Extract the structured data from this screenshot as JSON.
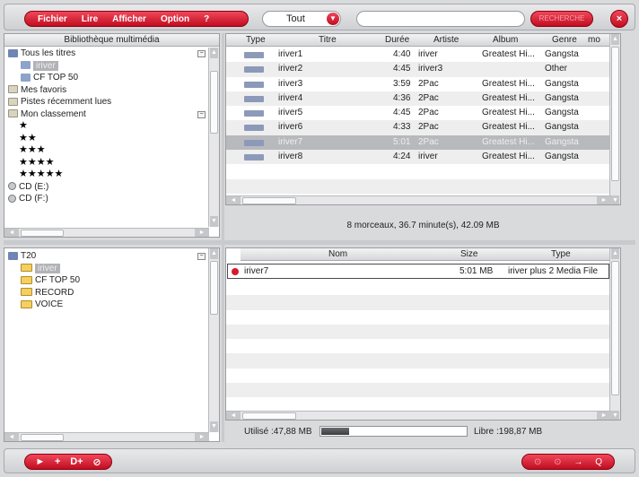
{
  "menu": {
    "items": [
      "Fichier",
      "Lire",
      "Afficher",
      "Option",
      "?"
    ]
  },
  "filter": {
    "value": "Tout"
  },
  "search": {
    "placeholder": "",
    "button_label": "RECHERCHE"
  },
  "library": {
    "title": "Bibliothèque multimédia",
    "items": [
      {
        "label": "Tous les titres",
        "level": 0,
        "icon": "library-icon"
      },
      {
        "label": "iriver",
        "level": 1,
        "icon": "playlist-icon",
        "selected": true
      },
      {
        "label": "CF TOP 50",
        "level": 1,
        "icon": "playlist-icon"
      },
      {
        "label": "Mes favoris",
        "level": 0,
        "icon": "folder-icon"
      },
      {
        "label": "Pistes récemment lues",
        "level": 0,
        "icon": "folder-icon"
      },
      {
        "label": "Mon classement",
        "level": 0,
        "icon": "folder-icon"
      },
      {
        "label": "★",
        "level": 1,
        "icon": ""
      },
      {
        "label": "★★",
        "level": 1,
        "icon": ""
      },
      {
        "label": "★★★",
        "level": 1,
        "icon": ""
      },
      {
        "label": "★★★★",
        "level": 1,
        "icon": ""
      },
      {
        "label": "★★★★★",
        "level": 1,
        "icon": ""
      },
      {
        "label": "CD (E:)",
        "level": 0,
        "icon": "cd-icon"
      },
      {
        "label": "CD (F:)",
        "level": 0,
        "icon": "cd-icon"
      }
    ]
  },
  "tracks": {
    "columns": [
      "Type",
      "Titre",
      "Durée",
      "Artiste",
      "Album",
      "Genre",
      "mo"
    ],
    "rows": [
      {
        "type": "MP3",
        "title": "iriver1",
        "duration": "4:40",
        "artist": "iriver",
        "album": "Greatest Hi...",
        "genre": "Gangsta"
      },
      {
        "type": "MP3",
        "title": "iriver2",
        "duration": "4:45",
        "artist": "iriver3",
        "album": "",
        "genre": "Other"
      },
      {
        "type": "MP3",
        "title": "iriver3",
        "duration": "3:59",
        "artist": "2Pac",
        "album": "Greatest Hi...",
        "genre": "Gangsta"
      },
      {
        "type": "MP3",
        "title": "iriver4",
        "duration": "4:36",
        "artist": "2Pac",
        "album": "Greatest Hi...",
        "genre": "Gangsta"
      },
      {
        "type": "MP3",
        "title": "iriver5",
        "duration": "4:45",
        "artist": "2Pac",
        "album": "Greatest Hi...",
        "genre": "Gangsta"
      },
      {
        "type": "MP3",
        "title": "iriver6",
        "duration": "4:33",
        "artist": "2Pac",
        "album": "Greatest Hi...",
        "genre": "Gangsta"
      },
      {
        "type": "MP3",
        "title": "iriver7",
        "duration": "5:01",
        "artist": "2Pac",
        "album": "Greatest Hi...",
        "genre": "Gangsta",
        "selected": true
      },
      {
        "type": "MP3",
        "title": "iriver8",
        "duration": "4:24",
        "artist": "iriver",
        "album": "Greatest Hi...",
        "genre": "Gangsta"
      }
    ],
    "summary": "8 morceaux, 36.7 minute(s), 42.09 MB"
  },
  "device": {
    "items": [
      {
        "label": "T20",
        "level": 0,
        "icon": "device-icon"
      },
      {
        "label": "iriver",
        "level": 1,
        "icon": "folder-icon",
        "selected": true
      },
      {
        "label": "CF TOP 50",
        "level": 1,
        "icon": "folder-icon"
      },
      {
        "label": "RECORD",
        "level": 1,
        "icon": "folder-icon"
      },
      {
        "label": "VOICE",
        "level": 1,
        "icon": "folder-icon"
      }
    ]
  },
  "transfer": {
    "columns": [
      "Nom",
      "Size",
      "Type"
    ],
    "rows": [
      {
        "name": "iriver7",
        "size": "5:01  MB",
        "type": "iriver plus 2 Media File"
      }
    ],
    "used_label": "Utilisé :47,88 MB",
    "free_label": "Libre :198,87 MB",
    "used_fraction": 0.19
  },
  "bottom": {
    "actions": [
      "►",
      "+",
      "D+",
      "⊘"
    ],
    "transfer_actions": [
      "⊙",
      "⊙",
      "→",
      "Q"
    ]
  },
  "colors": {
    "accent": "#d91a2e",
    "selection": "#b8b9bc"
  }
}
